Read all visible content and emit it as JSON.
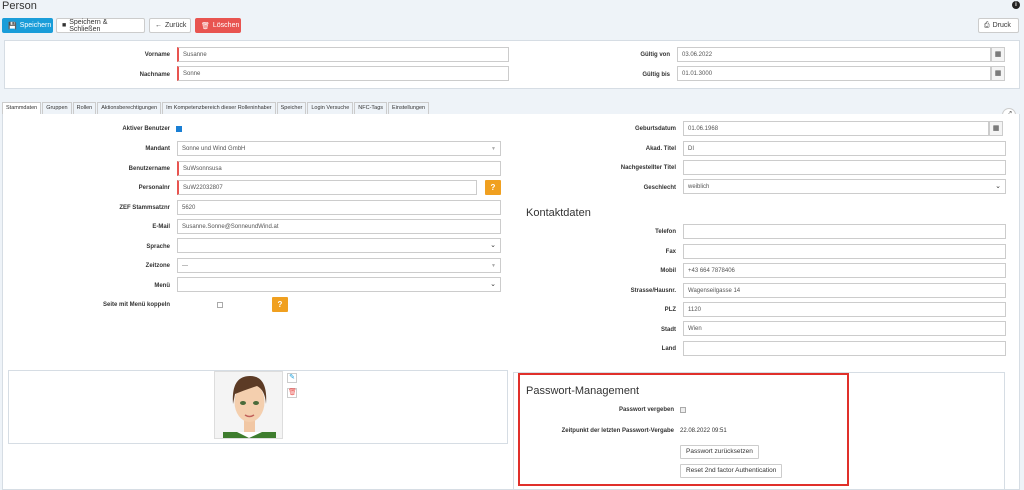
{
  "page": {
    "title": "Person"
  },
  "toolbar": {
    "save": "Speichern",
    "save_close": "Speichern & Schließen",
    "back": "Zurück",
    "delete": "Löschen",
    "print": "Druck"
  },
  "header": {
    "vorname_label": "Vorname",
    "vorname": "Susanne",
    "nachname_label": "Nachname",
    "nachname": "Sonne",
    "gueltig_von_label": "Gültig von",
    "gueltig_von": "03.06.2022",
    "gueltig_bis_label": "Gültig bis",
    "gueltig_bis": "01.01.3000"
  },
  "tabs": [
    "Stammdaten",
    "Gruppen",
    "Rollen",
    "Aktionsberechtigungen",
    "Im Kompetenzbereich dieser Rolleninhaber",
    "Speicher",
    "Login Versuche",
    "NFC-Tags",
    "Einstellungen"
  ],
  "left": {
    "aktiver_label": "Aktiver Benutzer",
    "mandant_label": "Mandant",
    "mandant": "Sonne und Wind GmbH",
    "benutzername_label": "Benutzername",
    "benutzername": "SuWsonnsusa",
    "personalnr_label": "Personalnr",
    "personalnr": "SuW22032807",
    "zef_label": "ZEF Stammsatznr",
    "zef": "5620",
    "email_label": "E-Mail",
    "email": "Susanne.Sonne@SonneundWind.at",
    "sprache_label": "Sprache",
    "sprache": "",
    "zeitzone_label": "Zeitzone",
    "zeitzone": "---",
    "menu_label": "Menü",
    "menu": "",
    "koppeln_label": "Seite mit Menü koppeln"
  },
  "right": {
    "geburtsdatum_label": "Geburtsdatum",
    "geburtsdatum": "01.06.1968",
    "akad_label": "Akad. Titel",
    "akad": "DI",
    "nachgestellt_label": "Nachgestellter Titel",
    "nachgestellt": "",
    "geschlecht_label": "Geschlecht",
    "geschlecht": "weiblich",
    "kontakt_heading": "Kontaktdaten",
    "telefon_label": "Telefon",
    "telefon": "",
    "fax_label": "Fax",
    "fax": "",
    "mobil_label": "Mobil",
    "mobil": "+43 664 7878406",
    "strasse_label": "Strasse/Hausnr.",
    "strasse": "Wagenseilgasse 14",
    "plz_label": "PLZ",
    "plz": "1120",
    "stadt_label": "Stadt",
    "stadt": "Wien",
    "land_label": "Land",
    "land": ""
  },
  "password": {
    "heading": "Passwort-Management",
    "vergeben_label": "Passwort vergeben",
    "zeitpunkt_label": "Zeitpunkt der letzten Passwort-Vergabe",
    "zeitpunkt": "22.08.2022 09:51",
    "reset_button": "Passwort zurücksetzen",
    "reset2fa_button": "Reset 2nd factor Authentication"
  },
  "colors": {
    "primary": "#1a9dd9",
    "danger": "#e85450",
    "help": "#f0a020",
    "highlight": "#e0302a"
  }
}
